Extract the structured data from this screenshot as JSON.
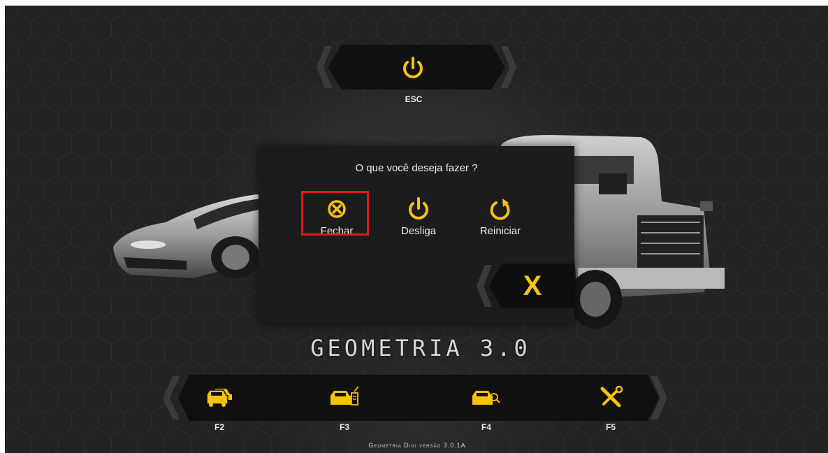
{
  "header": {
    "esc_label": "ESC"
  },
  "dialog": {
    "title": "O que você deseja fazer ?",
    "options": [
      {
        "label": "Fechar",
        "icon": "close-circle-icon"
      },
      {
        "label": "Desliga",
        "icon": "power-icon"
      },
      {
        "label": "Reiniciar",
        "icon": "restart-icon"
      }
    ],
    "close_label": "X"
  },
  "logo": {
    "text": "GEOMETRIA 3.0"
  },
  "toolbar": {
    "items": [
      {
        "key": "F2",
        "icon": "two-cars-icon"
      },
      {
        "key": "F3",
        "icon": "car-document-icon"
      },
      {
        "key": "F4",
        "icon": "car-search-icon"
      },
      {
        "key": "F5",
        "icon": "tools-icon"
      }
    ]
  },
  "footer": {
    "version": "Geometria Digi versão 3.0.1A"
  },
  "colors": {
    "accent": "#f5c211",
    "highlight": "#e01818",
    "panel": "#1c1c1c"
  }
}
